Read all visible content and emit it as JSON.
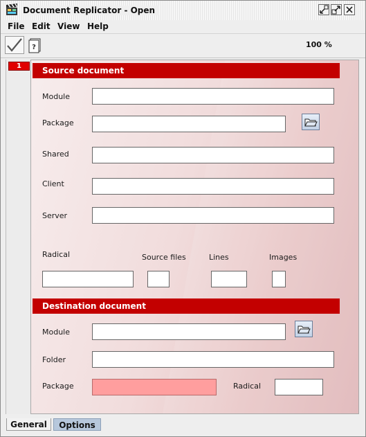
{
  "window": {
    "title": "Document Replicator - Open",
    "icon": "clapperboard-icon"
  },
  "menu": [
    "File",
    "Edit",
    "View",
    "Help"
  ],
  "toolbar": {
    "buttons": [
      {
        "icon": "checkmark-icon"
      },
      {
        "icon": "help-document-icon"
      }
    ],
    "zoom": "100 %"
  },
  "page_tabs": [
    {
      "label": "1",
      "color": "#e00000"
    }
  ],
  "source": {
    "title": "Source document",
    "module_label": "Module",
    "package_label": "Package",
    "shared_label": "Shared",
    "client_label": "Client",
    "server_label": "Server",
    "radical_label": "Radical",
    "source_files_label": "Source files",
    "lines_label": "Lines",
    "images_label": "Images",
    "module_value": "",
    "package_value": "",
    "shared_value": "",
    "client_value": "",
    "server_value": "",
    "radical_value": "",
    "source_files_value": "",
    "lines_value": "",
    "images_value": ""
  },
  "destination": {
    "title": "Destination document",
    "module_label": "Module",
    "folder_label": "Folder",
    "package_label": "Package",
    "radical_label": "Radical",
    "module_value": "",
    "folder_value": "",
    "package_value": "",
    "radical_value": ""
  },
  "bottom_tabs": [
    {
      "label": "General",
      "active": true
    },
    {
      "label": "Options",
      "active": false
    }
  ],
  "colors": {
    "section_header": "#c30000",
    "required_field": "#ff9e9e",
    "accent_tab": "#e00000"
  }
}
